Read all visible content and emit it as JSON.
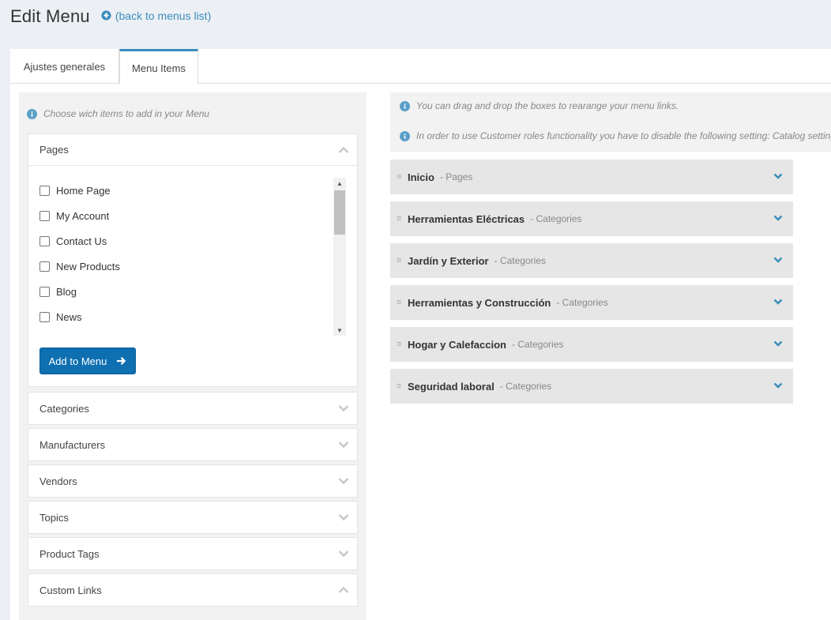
{
  "header": {
    "title": "Edit Menu",
    "back_link": "(back to menus list)"
  },
  "tabs": [
    {
      "label": "Ajustes generales",
      "active": false
    },
    {
      "label": "Menu Items",
      "active": true
    }
  ],
  "left": {
    "info": "Choose wich items to add in your Menu",
    "pages_panel": {
      "title": "Pages",
      "items": [
        "Home Page",
        "My Account",
        "Contact Us",
        "New Products",
        "Blog",
        "News",
        ""
      ],
      "add_button": "Add to Menu"
    },
    "collapsed_panels": [
      {
        "title": "Categories",
        "expanded": false
      },
      {
        "title": "Manufacturers",
        "expanded": false
      },
      {
        "title": "Vendors",
        "expanded": false
      },
      {
        "title": "Topics",
        "expanded": false
      },
      {
        "title": "Product Tags",
        "expanded": false
      },
      {
        "title": "Custom Links",
        "expanded": true
      }
    ]
  },
  "right": {
    "info_1": "You can drag and drop the boxes to rearange your menu links.",
    "info_2": "In order to use Customer roles functionality you have to disable the following setting: Catalog setting",
    "menu_items": [
      {
        "title": "Inicio",
        "type": "- Pages"
      },
      {
        "title": "Herramientas Eléctricas",
        "type": "- Categories"
      },
      {
        "title": "Jardín y Exterior",
        "type": "- Categories"
      },
      {
        "title": "Herramientas y Construcción",
        "type": "- Categories"
      },
      {
        "title": "Hogar y Calefaccion",
        "type": "- Categories"
      },
      {
        "title": "Seguridad laboral",
        "type": "- Categories"
      }
    ]
  },
  "colors": {
    "accent": "#3c8dbc",
    "button": "#0e6fb1",
    "info_icon": "#5a9fc7"
  },
  "icons": [
    "back-circle-arrow-icon",
    "info-icon",
    "chevron-up-icon",
    "chevron-down-icon",
    "arrow-right-icon",
    "drag-handle-icon"
  ]
}
